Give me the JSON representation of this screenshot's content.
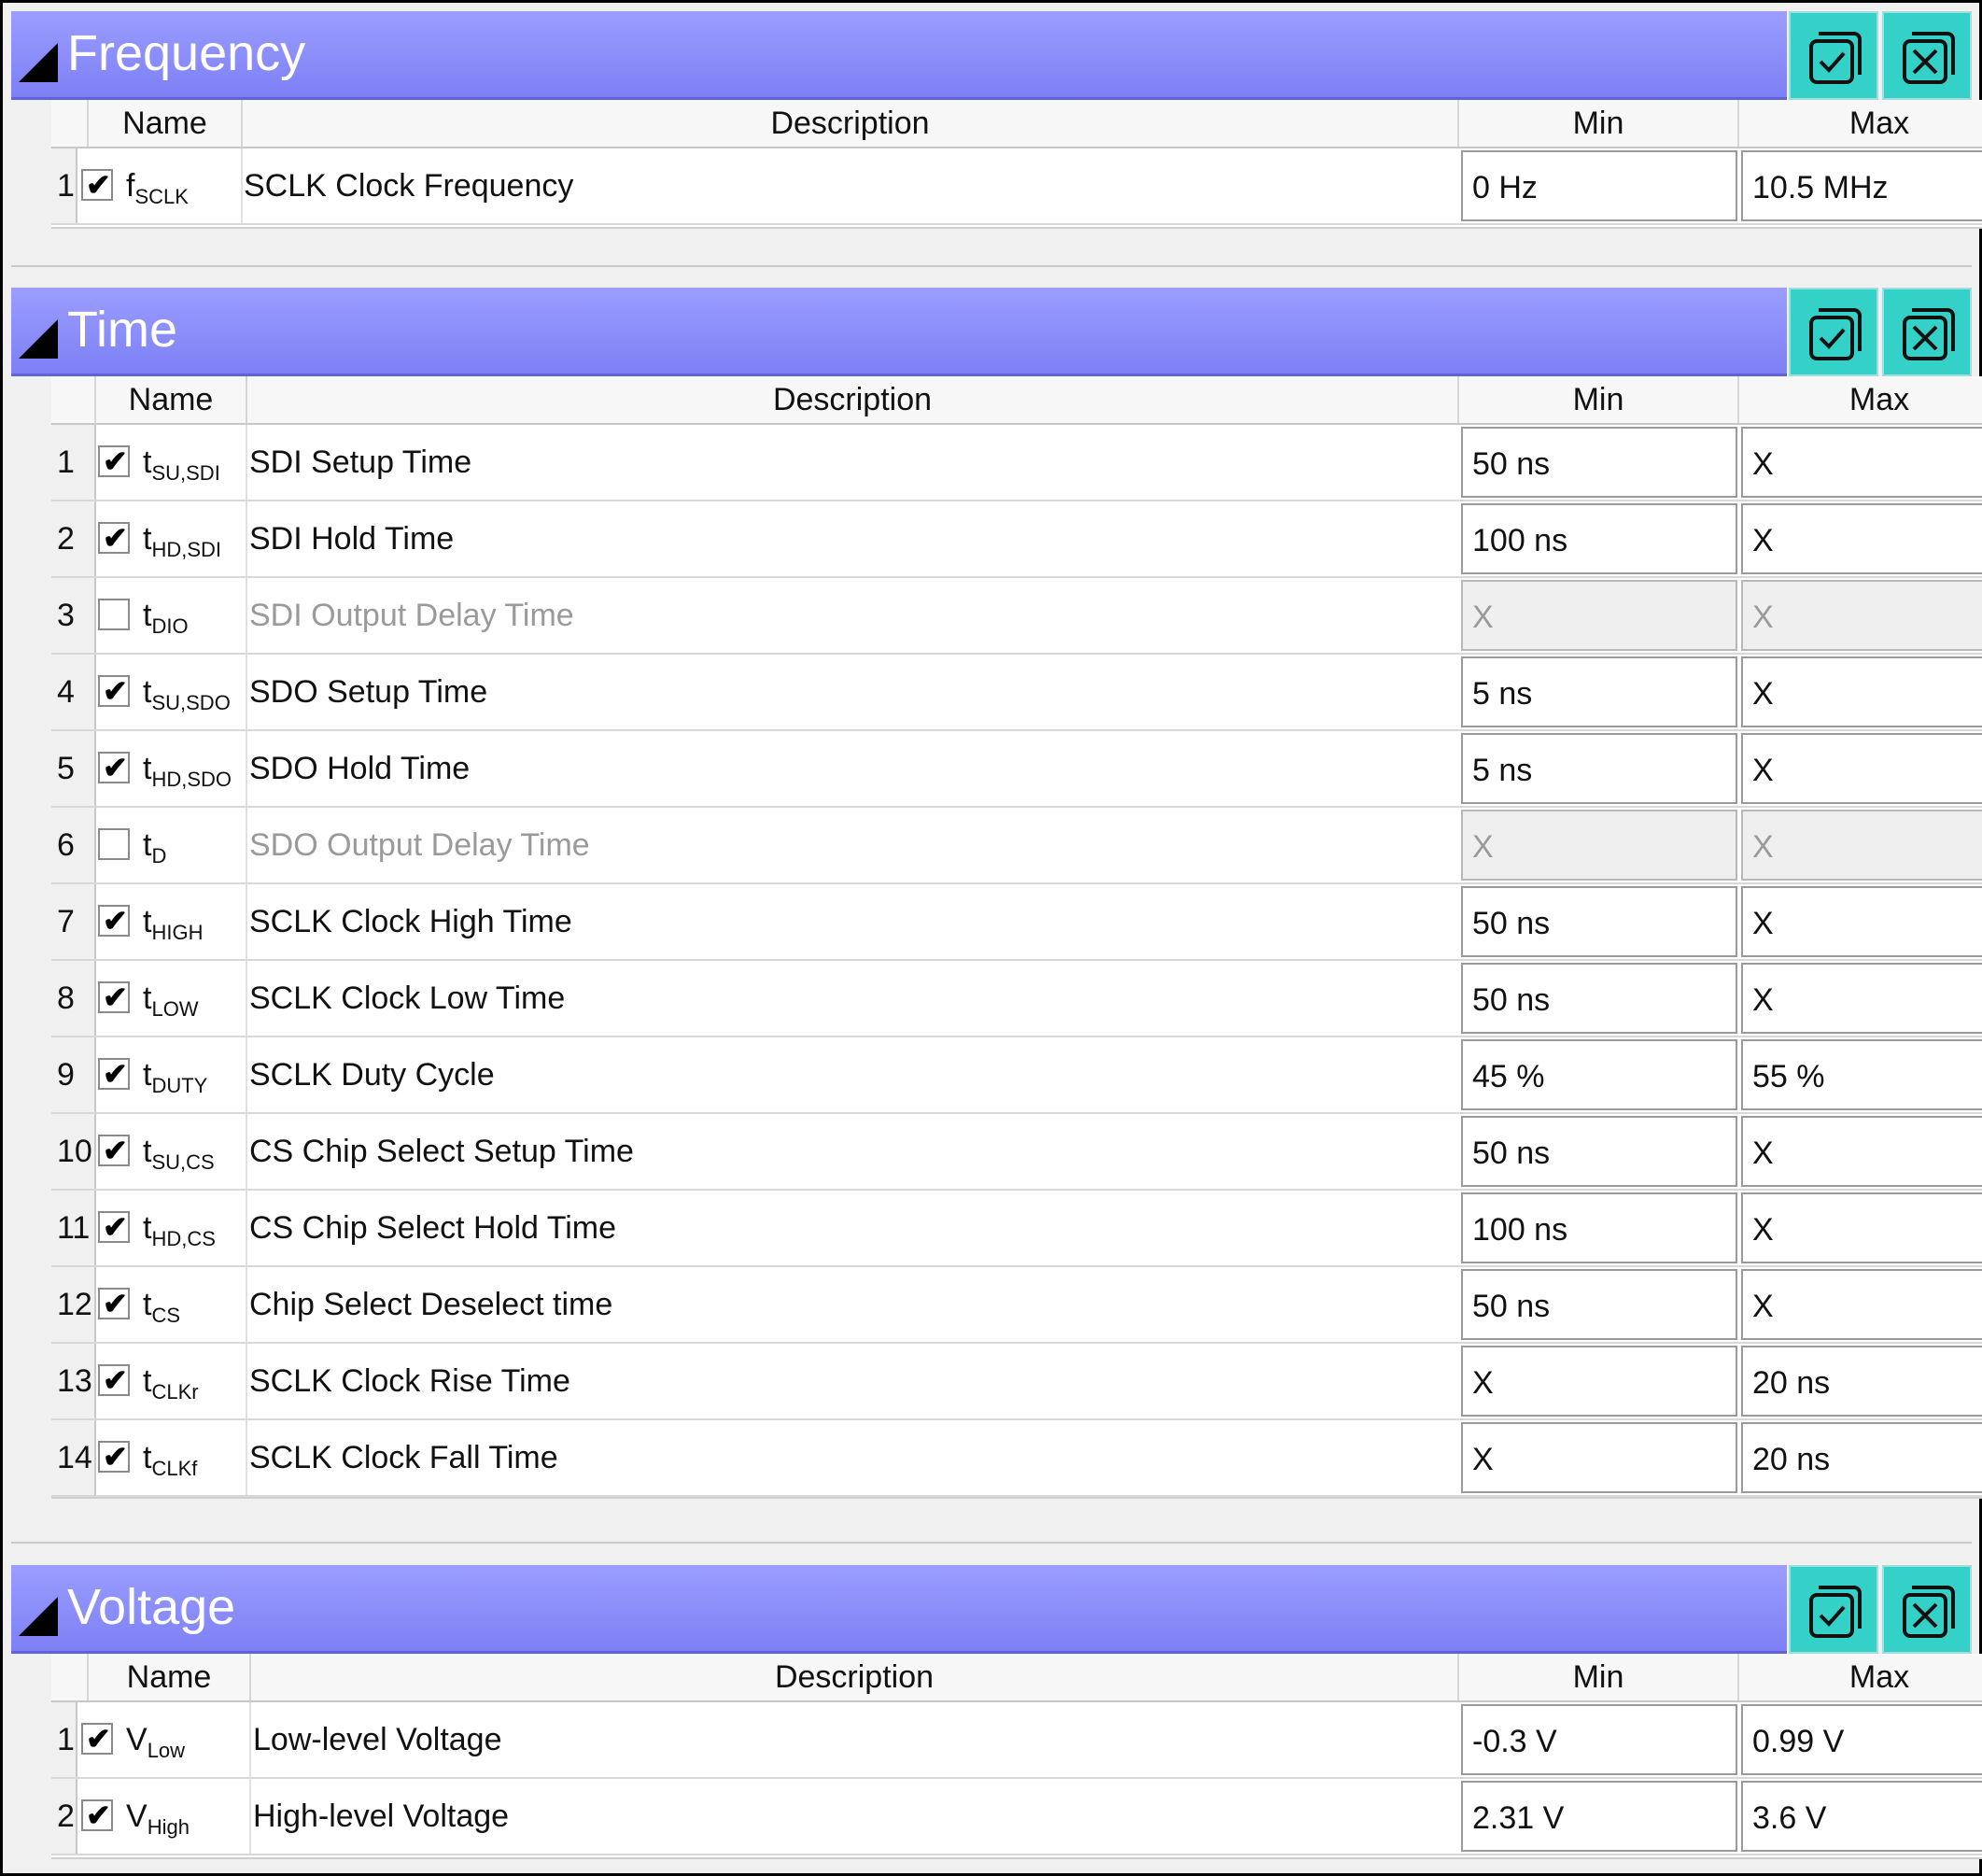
{
  "sections": [
    {
      "title": "Frequency",
      "headers": {
        "name": "Name",
        "description": "Description",
        "min": "Min",
        "max": "Max"
      },
      "rows": [
        {
          "num": "1",
          "checked": true,
          "sym": "f",
          "sub": "SCLK",
          "desc": "SCLK Clock Frequency",
          "min": "0 Hz",
          "max": "10.5 MHz"
        }
      ]
    },
    {
      "title": "Time",
      "headers": {
        "name": "Name",
        "description": "Description",
        "min": "Min",
        "max": "Max"
      },
      "rows": [
        {
          "num": "1",
          "checked": true,
          "sym": "t",
          "sub": "SU,SDI",
          "desc": "SDI Setup Time",
          "min": "50 ns",
          "max": "X"
        },
        {
          "num": "2",
          "checked": true,
          "sym": "t",
          "sub": "HD,SDI",
          "desc": "SDI Hold Time",
          "min": "100 ns",
          "max": "X"
        },
        {
          "num": "3",
          "checked": false,
          "sym": "t",
          "sub": "DIO",
          "desc": "SDI Output Delay Time",
          "min": "X",
          "max": "X"
        },
        {
          "num": "4",
          "checked": true,
          "sym": "t",
          "sub": "SU,SDO",
          "desc": "SDO Setup Time",
          "min": "5 ns",
          "max": "X"
        },
        {
          "num": "5",
          "checked": true,
          "sym": "t",
          "sub": "HD,SDO",
          "desc": "SDO Hold Time",
          "min": "5 ns",
          "max": "X"
        },
        {
          "num": "6",
          "checked": false,
          "sym": "t",
          "sub": "D",
          "desc": "SDO Output Delay Time",
          "min": "X",
          "max": "X"
        },
        {
          "num": "7",
          "checked": true,
          "sym": "t",
          "sub": "HIGH",
          "desc": "SCLK Clock High Time",
          "min": "50 ns",
          "max": "X"
        },
        {
          "num": "8",
          "checked": true,
          "sym": "t",
          "sub": "LOW",
          "desc": "SCLK Clock Low Time",
          "min": "50 ns",
          "max": "X"
        },
        {
          "num": "9",
          "checked": true,
          "sym": "t",
          "sub": "DUTY",
          "desc": "SCLK Duty Cycle",
          "min": "45 %",
          "max": "55 %"
        },
        {
          "num": "10",
          "checked": true,
          "sym": "t",
          "sub": "SU,CS",
          "desc": "CS Chip Select Setup Time",
          "min": "50 ns",
          "max": "X"
        },
        {
          "num": "11",
          "checked": true,
          "sym": "t",
          "sub": "HD,CS",
          "desc": "CS Chip Select Hold Time",
          "min": "100 ns",
          "max": "X"
        },
        {
          "num": "12",
          "checked": true,
          "sym": "t",
          "sub": "CS",
          "desc": "Chip Select Deselect time",
          "min": "50 ns",
          "max": "X"
        },
        {
          "num": "13",
          "checked": true,
          "sym": "t",
          "sub": "CLKr",
          "desc": "SCLK Clock Rise Time",
          "min": "X",
          "max": "20 ns"
        },
        {
          "num": "14",
          "checked": true,
          "sym": "t",
          "sub": "CLKf",
          "desc": "SCLK Clock Fall Time",
          "min": "X",
          "max": "20 ns"
        }
      ]
    },
    {
      "title": "Voltage",
      "headers": {
        "name": "Name",
        "description": "Description",
        "min": "Min",
        "max": "Max"
      },
      "rows": [
        {
          "num": "1",
          "checked": true,
          "sym": "V",
          "sub": "Low",
          "desc": "Low-level Voltage",
          "min": "-0.3 V",
          "max": "0.99 V"
        },
        {
          "num": "2",
          "checked": true,
          "sym": "V",
          "sub": "High",
          "desc": "High-level Voltage",
          "min": "2.31 V",
          "max": "3.6 V"
        }
      ]
    }
  ],
  "icons": {
    "check_all": "check-all-icon",
    "uncheck_all": "uncheck-all-icon"
  },
  "colors": {
    "header": "#8a8dfa",
    "button": "#33d1c8",
    "disabled_text": "#9a9a9a"
  }
}
